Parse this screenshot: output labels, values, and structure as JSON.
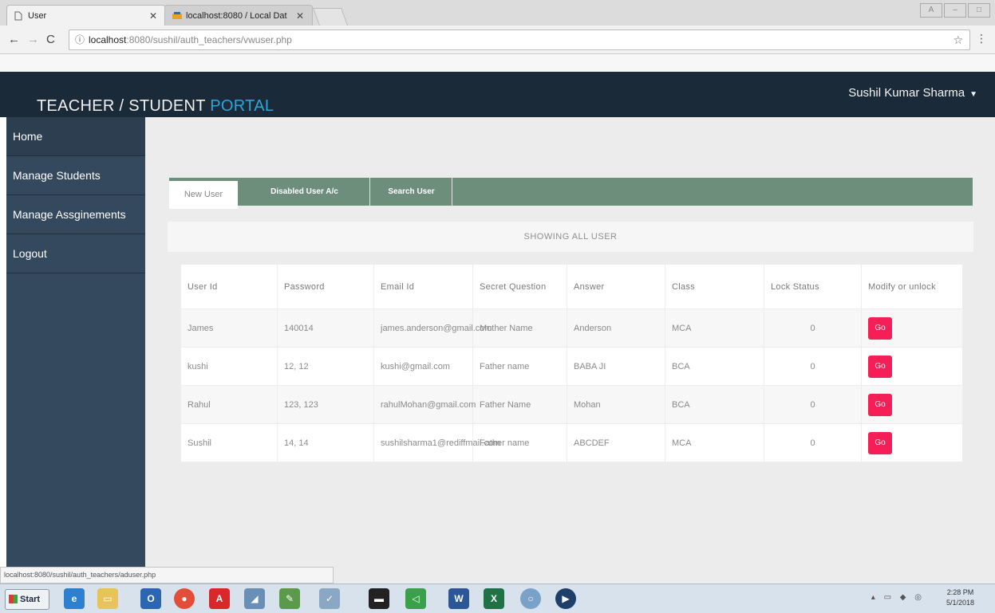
{
  "browser": {
    "tabs": [
      {
        "title": "User",
        "active": true
      },
      {
        "title": "localhost:8080 / Local Dat",
        "active": false
      }
    ],
    "address": {
      "host": "localhost",
      "path": ":8080/sushil/auth_teachers/vwuser.php"
    },
    "status_url": "localhost:8080/sushil/auth_teachers/aduser.php"
  },
  "app": {
    "brand_main": "TEACHER / STUDENT",
    "brand_accent": "PORTAL",
    "user_name": "Sushil Kumar Sharma",
    "colors": {
      "header": "#1b2a38",
      "sidebar": "#34495e",
      "accent": "#2aa7d9",
      "tabbar": "#6d8e7a",
      "go_button": "#f51e57"
    }
  },
  "sidebar": {
    "items": [
      {
        "label": "Home"
      },
      {
        "label": "Manage Students"
      },
      {
        "label": "Manage Assginements"
      },
      {
        "label": "Logout"
      }
    ]
  },
  "tabs": {
    "new_user": "New User",
    "disabled": "Disabled User A/c",
    "search": "Search User"
  },
  "panel": {
    "heading": "SHOWING ALL USER"
  },
  "table": {
    "headers": [
      "User Id",
      "Password",
      "Email Id",
      "Secret Question",
      "Answer",
      "Class",
      "Lock Status",
      "Modify or unlock"
    ],
    "rows": [
      {
        "user_id": "James",
        "password": "140014",
        "email": "james.anderson@gmail.com",
        "question": "Mother Name",
        "answer": "Anderson",
        "class": "MCA",
        "lock": "0",
        "action": "Go"
      },
      {
        "user_id": "kushi",
        "password": "12, 12",
        "email": "kushi@gmail.com",
        "question": "Father name",
        "answer": "BABA JI",
        "class": "BCA",
        "lock": "0",
        "action": "Go"
      },
      {
        "user_id": "Rahul",
        "password": "123, 123",
        "email": "rahulMohan@gmail.com",
        "question": "Father Name",
        "answer": "Mohan",
        "class": "BCA",
        "lock": "0",
        "action": "Go"
      },
      {
        "user_id": "Sushil",
        "password": "14, 14",
        "email": "sushilsharma1@rediffmail.com",
        "question": "Father name",
        "answer": "ABCDEF",
        "class": "MCA",
        "lock": "0",
        "action": "Go"
      }
    ]
  },
  "taskbar": {
    "start_label": "Start",
    "time": "2:28 PM",
    "date": "5/1/2018",
    "pinned": [
      "ie-icon",
      "explorer-icon",
      "outlook-icon",
      "chrome-icon",
      "acrobat-icon",
      "utility-icon",
      "paint-icon",
      "notepad-icon",
      "terminal-icon",
      "visual-studio-icon",
      "word-icon",
      "excel-icon",
      "search-icon",
      "media-icon"
    ]
  }
}
